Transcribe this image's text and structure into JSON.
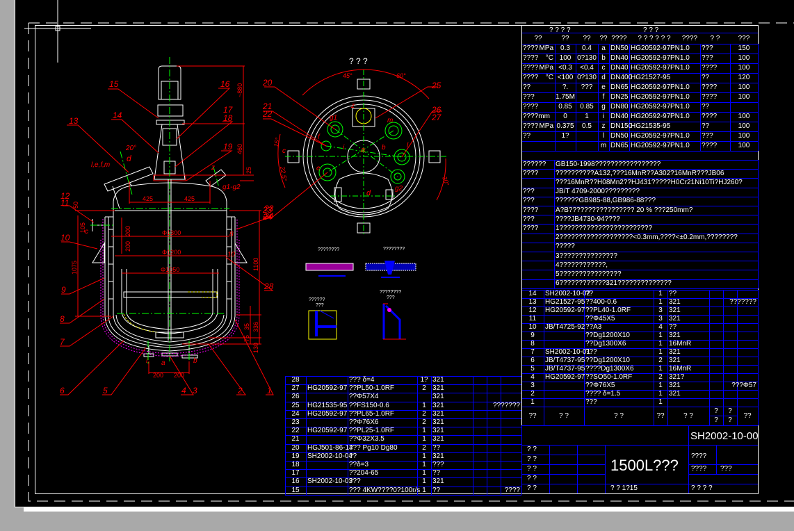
{
  "colors": {
    "background": "#000000",
    "frame": "#ffffff",
    "grid": "#0000ff",
    "dimension": "#ff0000",
    "centerline": "#00ff00",
    "insulation": "#ff00ff",
    "highlight": "#ffff00"
  },
  "drawing": {
    "top_view_title": "? ? ?",
    "labels": {
      "l1": "1",
      "l2": "2",
      "l3": "3",
      "l4": "4",
      "l5": "5",
      "l6": "6",
      "l7": "7",
      "l8": "8",
      "l9": "9",
      "l10": "10",
      "l11": "11",
      "l12": "12",
      "l13": "13",
      "l14": "14",
      "l15": "15",
      "l16": "16",
      "l17": "17",
      "l18": "18",
      "l19": "19",
      "l20": "20",
      "l21": "21",
      "l22": "22",
      "l23": "23",
      "l24": "24",
      "l25": "25",
      "l26": "26",
      "l27": "27",
      "l28": "28",
      "l23b": "23",
      "l24b": "24",
      "l28b": "28"
    },
    "dims": {
      "d880": "~880",
      "d460": "460",
      "d25": "25",
      "d425a": "425",
      "d425b": "425",
      "d50": "50",
      "d105": "105",
      "d200a": "200",
      "d200b": "200",
      "d1075": "1075",
      "dphi1300": "Φ1300",
      "dphi1200": "Φ1200",
      "dphi1050": "Φ1050",
      "d1100": "1100",
      "d35": "35",
      "d336": "336",
      "d75": "75",
      "d130": "130",
      "d200c": "200",
      "d200d": "200",
      "ang20": "20°",
      "ang45": "45°",
      "ang60": "60°",
      "ang15": "15°",
      "ang225": "22.5°",
      "ang30": "30°"
    },
    "nozzles": {
      "lefm": "l,e,f,m",
      "d": "d",
      "z": "z",
      "g12": "g1-g2",
      "c": "c",
      "a": "a",
      "b": "b",
      "i": "i",
      "g1": "g1",
      "m": "m",
      "f": "f",
      "l": "l",
      "e": "e",
      "g2": "g2",
      "tz": "z",
      "ti": "i",
      "ta": "a",
      "tb": "b",
      "tc": "c",
      "td": "d",
      "i8": "8",
      "i10": "10"
    },
    "details": {
      "cap1": "????????",
      "cap2": "????????",
      "cap3": "??????",
      "cap3b": "???",
      "cap4": "????????",
      "cap4b": "???"
    }
  },
  "spec_table": {
    "header_left": "? ? ? ?",
    "header_right": "?          ?          ?",
    "col_headers": [
      "??",
      "??",
      "??",
      "??",
      "????",
      "? ? ? ? ? ?",
      "????",
      "?     ?",
      "???"
    ],
    "rows": [
      [
        "????",
        "MPa",
        "0.3",
        "0.4",
        "a",
        "DN50",
        "HG20592-97",
        "PN1.0",
        "???",
        "150"
      ],
      [
        "????",
        "°C",
        "100",
        "0?130",
        "b",
        "DN40",
        "HG20592-97",
        "PN1.0",
        "???",
        "100"
      ],
      [
        "????",
        "MPa",
        "<0.3",
        "<0.4",
        "c",
        "DN40",
        "HG20592-97",
        "PN1.0",
        "????",
        "100"
      ],
      [
        "????",
        "°C",
        "<100",
        "0?130",
        "d",
        "DN400",
        "HG21527-95",
        "",
        "??",
        "120"
      ],
      [
        "??",
        "",
        "?.",
        "???",
        "e",
        "DN65",
        "HG20592-97",
        "PN1.0",
        "????",
        "100"
      ],
      [
        "???",
        "",
        "1.75M",
        "",
        "f",
        "DN25",
        "HG20592-97",
        "PN1.0",
        "????",
        "100"
      ],
      [
        "????",
        "",
        "0.85",
        "0.85",
        "g",
        "DN80",
        "HG20592-97",
        "PN1.0",
        "??",
        ""
      ],
      [
        "????mm",
        "",
        "0",
        "1",
        "i",
        "DN40",
        "HG20592-97",
        "PN1.0",
        "????",
        "100"
      ],
      [
        "????",
        "MPa",
        "0.375",
        "0.5",
        "z",
        "DN150",
        "HG21535-95",
        "",
        "??",
        "100"
      ],
      [
        "??",
        "",
        "1?",
        "",
        "l",
        "DN50",
        "HG20592-97",
        "PN1.0",
        "???",
        "100"
      ],
      [
        "",
        "",
        "",
        "",
        "m",
        "DN65",
        "HG20592-97",
        "PN1.0",
        "????",
        "100"
      ]
    ]
  },
  "notes": [
    [
      "??????",
      "GB150-1998?????????????????"
    ],
    [
      "????",
      "??????????A132,???16MnR??A302?16MnR???JB06"
    ],
    [
      "",
      "???16MnR??H08Mn2??HJ431?????H0Cr21Ni10Ti?HJ260?"
    ],
    [
      "???",
      "JB/T 4709-2000?????????"
    ],
    [
      "???",
      "??????GB985-88,GB986-88???"
    ],
    [
      "????",
      "A?B????????????????? 20 % ???250mm?"
    ],
    [
      "???",
      "????JB4730-94????"
    ],
    [
      "????",
      "1????????????????????????"
    ],
    [
      "",
      "2???????????????????<0.3mm,????<±0.2mm,????????"
    ],
    [
      "",
      "   ?????"
    ],
    [
      "",
      "3???????????????"
    ],
    [
      "",
      "4????????????,"
    ],
    [
      "",
      "5????????????????"
    ],
    [
      "",
      "6????????????321??????????????"
    ]
  ],
  "parts_right": [
    [
      "14",
      "SH2002-10-02",
      "??",
      "1",
      "??",
      ""
    ],
    [
      "13",
      "HG21527-95",
      "??400-0.6",
      "1",
      "321",
      "???????"
    ],
    [
      "12",
      "HG20592-97",
      "??PL40-1.0RF",
      "3",
      "321",
      ""
    ],
    [
      "11",
      "",
      "??Φ45X5",
      "3",
      "321",
      ""
    ],
    [
      "10",
      "JB/T4725-92",
      "??A3",
      "4",
      "??",
      ""
    ],
    [
      "9",
      "",
      "??Dg1200X10",
      "1",
      "321",
      ""
    ],
    [
      "8",
      "",
      "??Dg1300X6",
      "1",
      "16MnR",
      ""
    ],
    [
      "7",
      "SH2002-10-01",
      "???",
      "1",
      "321",
      ""
    ],
    [
      "6",
      "JB/T4737-95",
      "??Dg1200X10",
      "2",
      "321",
      ""
    ],
    [
      "5",
      "JB/T4737-95",
      "????Dg1300X6",
      "1",
      "16MnR",
      ""
    ],
    [
      "4",
      "HG20592-97",
      "??SO50-1.0RF",
      "2",
      "321?",
      ""
    ],
    [
      "3",
      "",
      "??Φ76X5",
      "1",
      "321",
      "???Φ57"
    ],
    [
      "2",
      "",
      "????  δ=1.5",
      "1",
      "321",
      ""
    ],
    [
      "1",
      "",
      "???",
      "1",
      "",
      ""
    ]
  ],
  "parts_header": [
    "??",
    "?     ?",
    "?               ?",
    "??",
    "?      ?",
    "?",
    "?",
    "?",
    "?",
    "??"
  ],
  "parts_left": [
    [
      "28",
      "",
      "???  δ=4",
      "1?",
      "321",
      ""
    ],
    [
      "27",
      "HG20592-97",
      "??PL50-1.0RF",
      "2",
      "321",
      ""
    ],
    [
      "26",
      "",
      "??Φ57X4",
      "",
      "321",
      ""
    ],
    [
      "25",
      "HG21535-95",
      "??FS150-0.6",
      "1",
      "321",
      "???????"
    ],
    [
      "24",
      "HG20592-97",
      "??PL65-1.0RF",
      "2",
      "321",
      ""
    ],
    [
      "23",
      "",
      "??Φ76X6",
      "2",
      "321",
      ""
    ],
    [
      "22",
      "HG20592-97",
      "??PL25-1.0RF",
      "1",
      "321",
      ""
    ],
    [
      "21",
      "",
      "??Φ32X3.5",
      "1",
      "321",
      ""
    ],
    [
      "20",
      "HGJ501-86-14",
      "??? Pg10  Dg80",
      "2",
      "??",
      ""
    ],
    [
      "19",
      "SH2002-10-04",
      "??",
      "1",
      "321",
      ""
    ],
    [
      "18",
      "",
      "??δ=3",
      "1",
      "???",
      ""
    ],
    [
      "17",
      "",
      "??204-65",
      "1",
      "??",
      ""
    ],
    [
      "16",
      "SH2002-10-03",
      "???",
      "1",
      "321",
      ""
    ],
    [
      "15",
      "",
      "??? 4KW????0?100r/s",
      "1",
      "??",
      "????"
    ]
  ],
  "title_block": {
    "drawing_number": "SH2002-10-00",
    "title": "1500L???",
    "sign_rows": [
      "? ?",
      "? ?",
      "? ?",
      "? ?",
      "? ?"
    ],
    "scale_row": "?    ?     1?15",
    "r1": "????",
    "r2a": "????",
    "r2b": "???",
    "r4": "?    ?          ?    ?"
  }
}
